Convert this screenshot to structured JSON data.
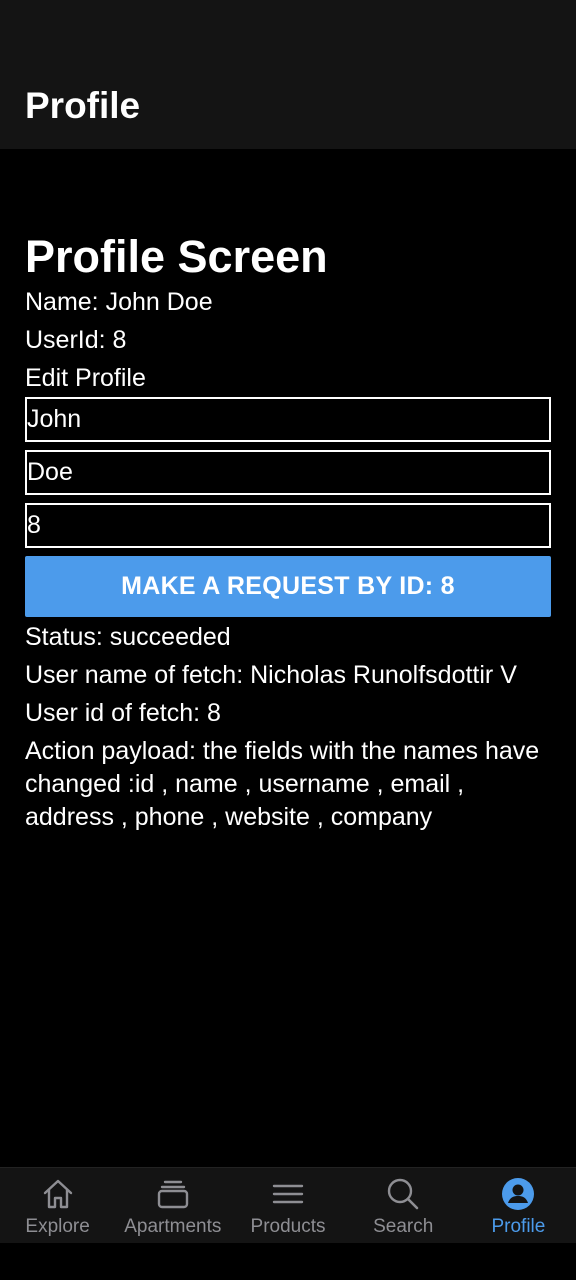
{
  "header": {
    "title": "Profile"
  },
  "profile": {
    "screen_title": "Profile Screen",
    "name_line": "Name: John Doe",
    "userid_line": "UserId: 8",
    "edit_label": "Edit Profile",
    "first_name_value": "John",
    "last_name_value": "Doe",
    "id_value": "8",
    "request_button_label": "MAKE A REQUEST BY ID: 8",
    "status_line": "Status: succeeded",
    "fetch_name_line": "User name of fetch: Nicholas Runolfsdottir V",
    "fetch_id_line": "User id of fetch: 8",
    "payload_line": "Action payload: the fields with the names have changed :id , name , username , email , address , phone , website , company"
  },
  "tabbar": {
    "items": [
      {
        "label": "Explore",
        "icon": "home-icon",
        "active": false
      },
      {
        "label": "Apartments",
        "icon": "stack-icon",
        "active": false
      },
      {
        "label": "Products",
        "icon": "menu-icon",
        "active": false
      },
      {
        "label": "Search",
        "icon": "search-icon",
        "active": false
      },
      {
        "label": "Profile",
        "icon": "person-circle-icon",
        "active": true
      }
    ]
  },
  "colors": {
    "accent": "#4c9beb",
    "inactive_tab": "#8e8e93",
    "header_bg": "#141414",
    "background": "#000000"
  }
}
